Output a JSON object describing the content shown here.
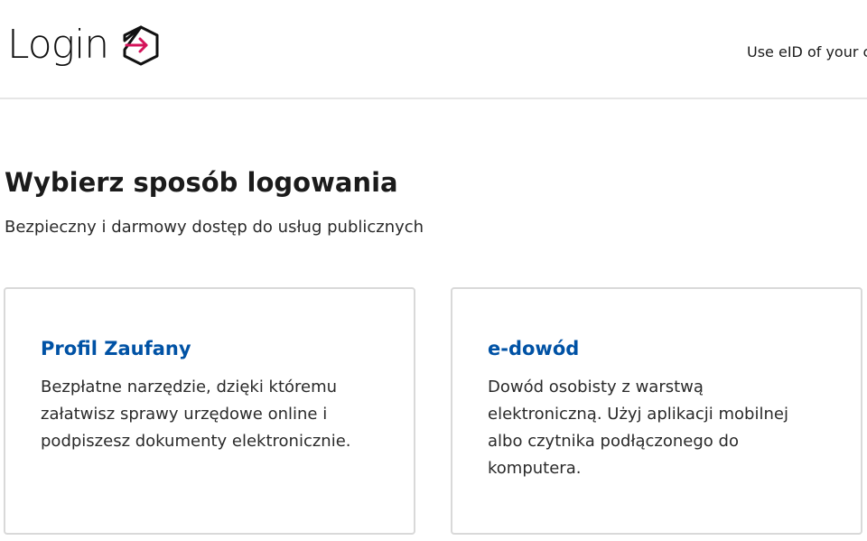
{
  "header": {
    "title": "Login",
    "icon": "login-arrow-icon",
    "eid_link": "Use eID of your c",
    "accent_color": "#d4145a"
  },
  "main": {
    "title": "Wybierz sposób logowania",
    "subtitle": "Bezpieczny i darmowy dostęp do usług publicznych",
    "cards": [
      {
        "title": "Profil Zaufany",
        "description": "Bezpłatne narzędzie, dzięki któremu załatwisz sprawy urzędowe online i podpiszesz dokumenty elektronicznie."
      },
      {
        "title": "e-dowód",
        "description": "Dowód osobisty z warstwą elektroniczną. Użyj aplikacji mobilnej albo czytnika podłączonego do komputera."
      }
    ]
  }
}
